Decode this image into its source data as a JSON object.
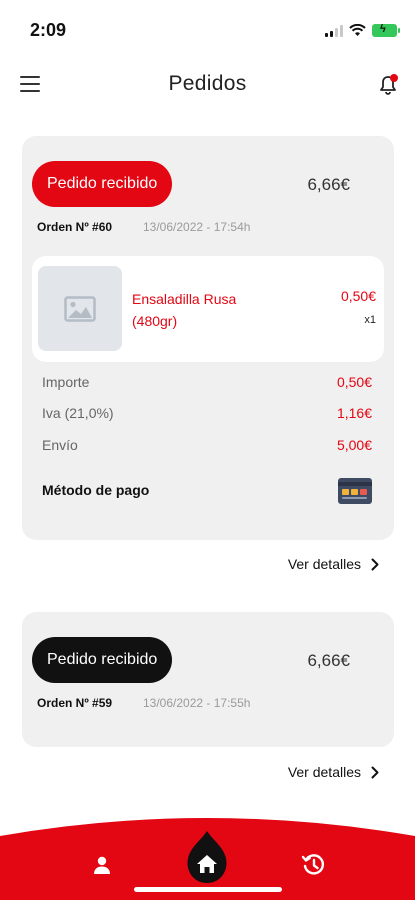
{
  "status_bar": {
    "time": "2:09"
  },
  "header": {
    "title": "Pedidos"
  },
  "colors": {
    "accent": "#e30613",
    "pill_dark": "#111111",
    "card_bg": "#f0f0f0",
    "nav_bg": "#e30613"
  },
  "icons": {
    "menu": "hamburger-menu-icon",
    "notifications": "bell-icon",
    "image_placeholder": "image-placeholder-icon",
    "payment": "credit-card-icon",
    "chevron": "chevron-right-icon",
    "nav_profile": "user-icon",
    "nav_home": "home-icon",
    "nav_history": "history-icon"
  },
  "orders": [
    {
      "status": "Pedido recibido",
      "total": "6,66€",
      "number": "Orden Nº #60",
      "date": "13/06/2022 - 17:54h",
      "item": {
        "name": "Ensaladilla Rusa (480gr)",
        "price": "0,50€",
        "qty": "x1"
      },
      "summary": [
        {
          "label": "Importe",
          "value": "0,50€"
        },
        {
          "label": "Iva (21,0%)",
          "value": "1,16€"
        },
        {
          "label": "Envío",
          "value": "5,00€"
        }
      ],
      "payment_label": "Método de pago",
      "details_label": "Ver detalles"
    },
    {
      "status": "Pedido recibido",
      "total": "6,66€",
      "number": "Orden Nº #59",
      "date": "13/06/2022 - 17:55h",
      "details_label": "Ver detalles"
    }
  ]
}
